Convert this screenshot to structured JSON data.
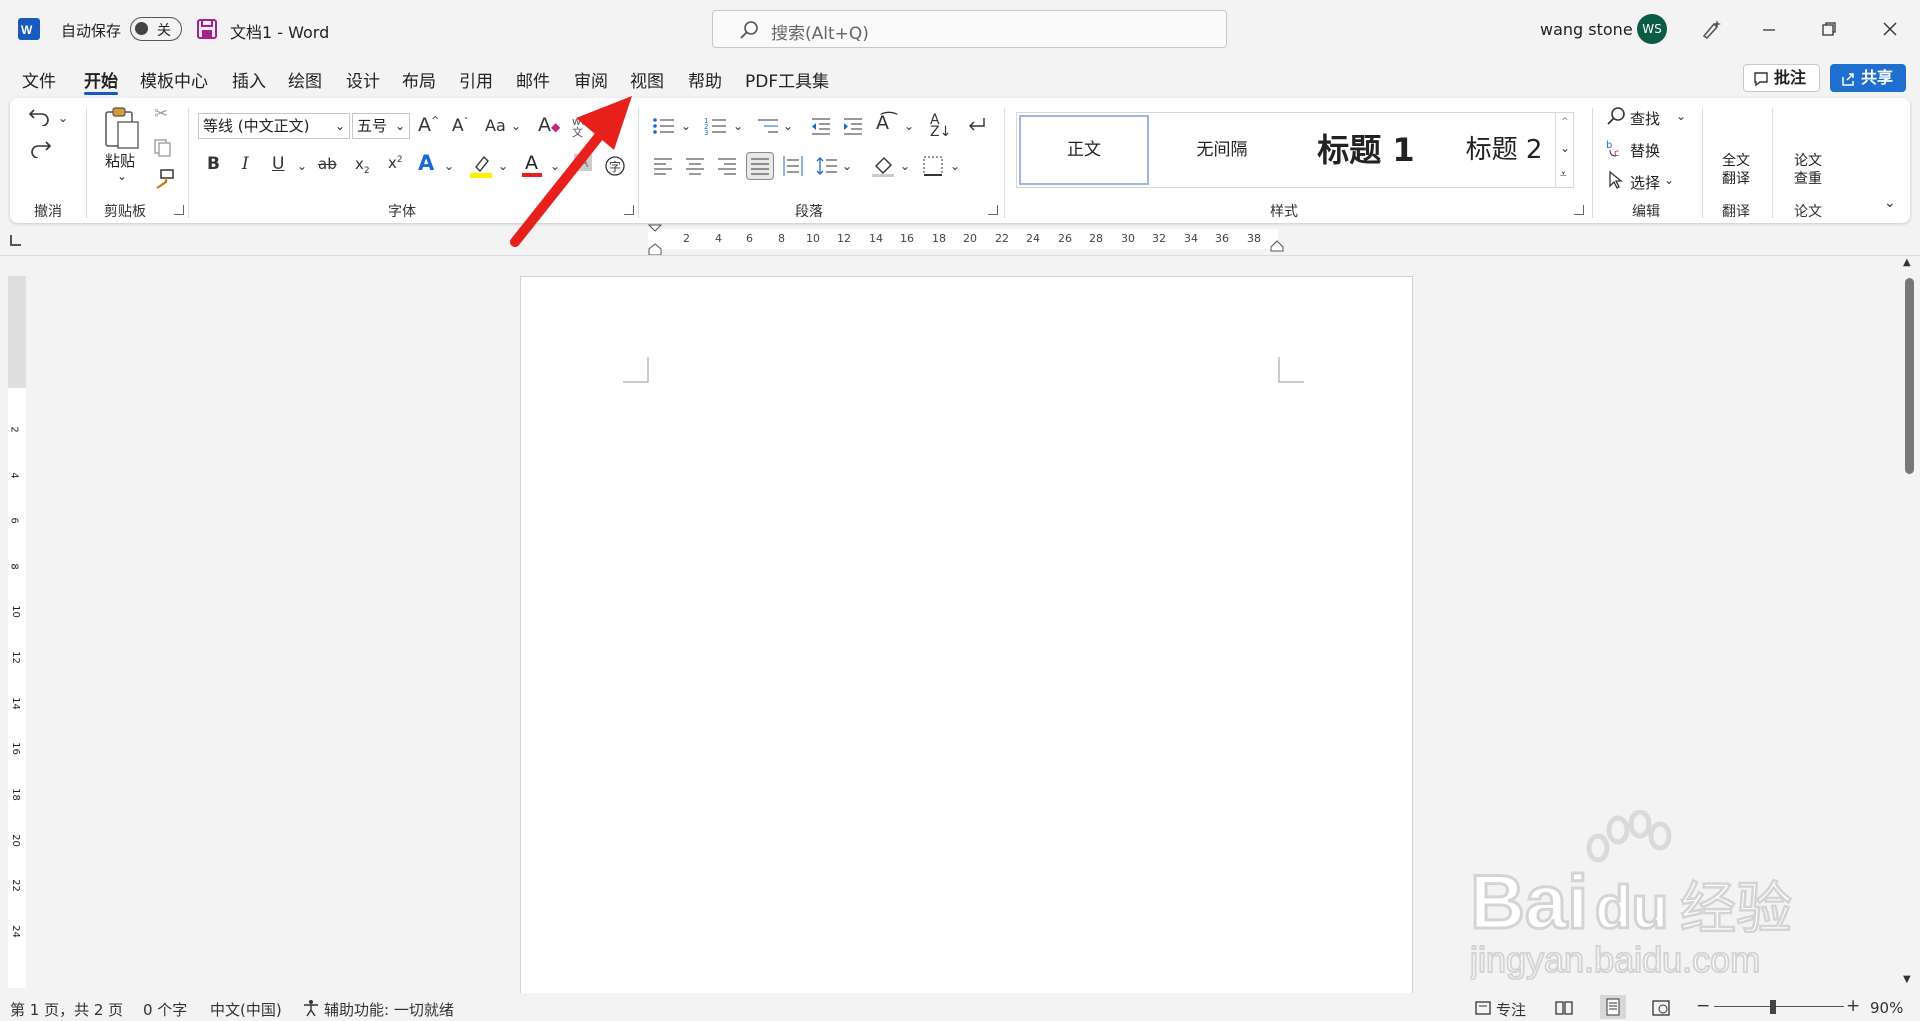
{
  "titlebar": {
    "autosave_label": "自动保存",
    "autosave_state": "关",
    "doc_title": "文档1  -  Word",
    "search_placeholder": "搜索(Alt+Q)",
    "user_name": "wang stone",
    "avatar_initials": "WS"
  },
  "menu": {
    "items": [
      "文件",
      "开始",
      "模板中心",
      "插入",
      "绘图",
      "设计",
      "布局",
      "引用",
      "邮件",
      "审阅",
      "视图",
      "帮助",
      "PDF工具集"
    ],
    "active": "开始",
    "comment_btn": "批注",
    "share_btn": "共享"
  },
  "ribbon": {
    "groups": {
      "undo": "撤消",
      "clipboard": "剪贴板",
      "font": "字体",
      "paragraph": "段落",
      "styles": "样式",
      "editing": "编辑",
      "translate": "翻译",
      "paper": "论文"
    },
    "paste_label": "粘贴",
    "font_name": "等线 (中文正文)",
    "font_size": "五号",
    "case_label": "Aa",
    "styles": [
      "正文",
      "无间隔",
      "标题 1",
      "标题 2"
    ],
    "find_label": "查找",
    "replace_label": "替换",
    "select_label": "选择",
    "full_translate_l1": "全文",
    "full_translate_l2": "翻译",
    "paper_check_l1": "论文",
    "paper_check_l2": "查重"
  },
  "ruler": {
    "numbers": [
      "2",
      "4",
      "6",
      "8",
      "10",
      "12",
      "14",
      "16",
      "18",
      "20",
      "22",
      "24",
      "26",
      "28",
      "30",
      "32",
      "34",
      "36",
      "38"
    ],
    "vnumbers": [
      "2",
      "4",
      "6",
      "8",
      "10",
      "12",
      "14",
      "16",
      "18",
      "20",
      "22",
      "24"
    ]
  },
  "status": {
    "page": "第 1 页，共 2 页",
    "words": "0 个字",
    "language": "中文(中国)",
    "accessibility": "辅助功能: 一切就绪",
    "focus": "专注",
    "zoom": "90%"
  },
  "watermark": {
    "brand": "Bai",
    "brand2": "du",
    "cn": "经验",
    "url": "jingyan.baidu.com"
  },
  "colors": {
    "accent": "#185abd",
    "share": "#1f6fd1",
    "arrow": "#e8201c",
    "avatar": "#0b5c44"
  }
}
